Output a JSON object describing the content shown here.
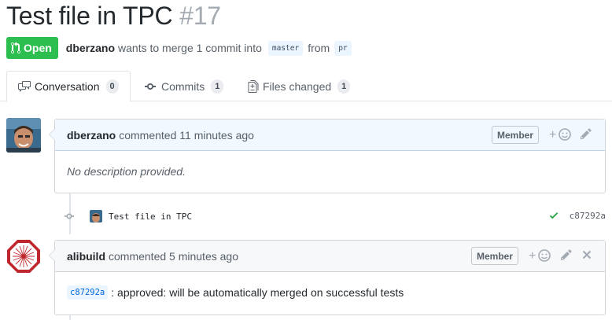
{
  "pr": {
    "title": "Test file in TPC",
    "number": "#17",
    "state": "Open",
    "author": "dberzano",
    "summary_text": "wants to merge 1 commit into",
    "base_branch": "master",
    "from_text": "from",
    "head_branch": "pr"
  },
  "tabs": [
    {
      "label": "Conversation",
      "count": "0",
      "icon": "comment-discussion-icon",
      "selected": true
    },
    {
      "label": "Commits",
      "count": "1",
      "icon": "git-commit-icon",
      "selected": false
    },
    {
      "label": "Files changed",
      "count": "1",
      "icon": "file-diff-icon",
      "selected": false
    }
  ],
  "timeline": {
    "comment1": {
      "author": "dberzano",
      "action_text": "commented 11 minutes ago",
      "role": "Member",
      "body": "No description provided."
    },
    "commit": {
      "message": "Test file in TPC",
      "sha": "c87292a",
      "status": "success"
    },
    "comment2": {
      "author": "alibuild",
      "action_text": "commented 5 minutes ago",
      "role": "Member",
      "sha": "c87292a",
      "body": ": approved: will be automatically merged on successful tests"
    }
  },
  "colors": {
    "open_green": "#2cbe4e",
    "link_blue": "#0366d6",
    "header_blue": "#f1f8ff",
    "success_green": "#28a745"
  }
}
